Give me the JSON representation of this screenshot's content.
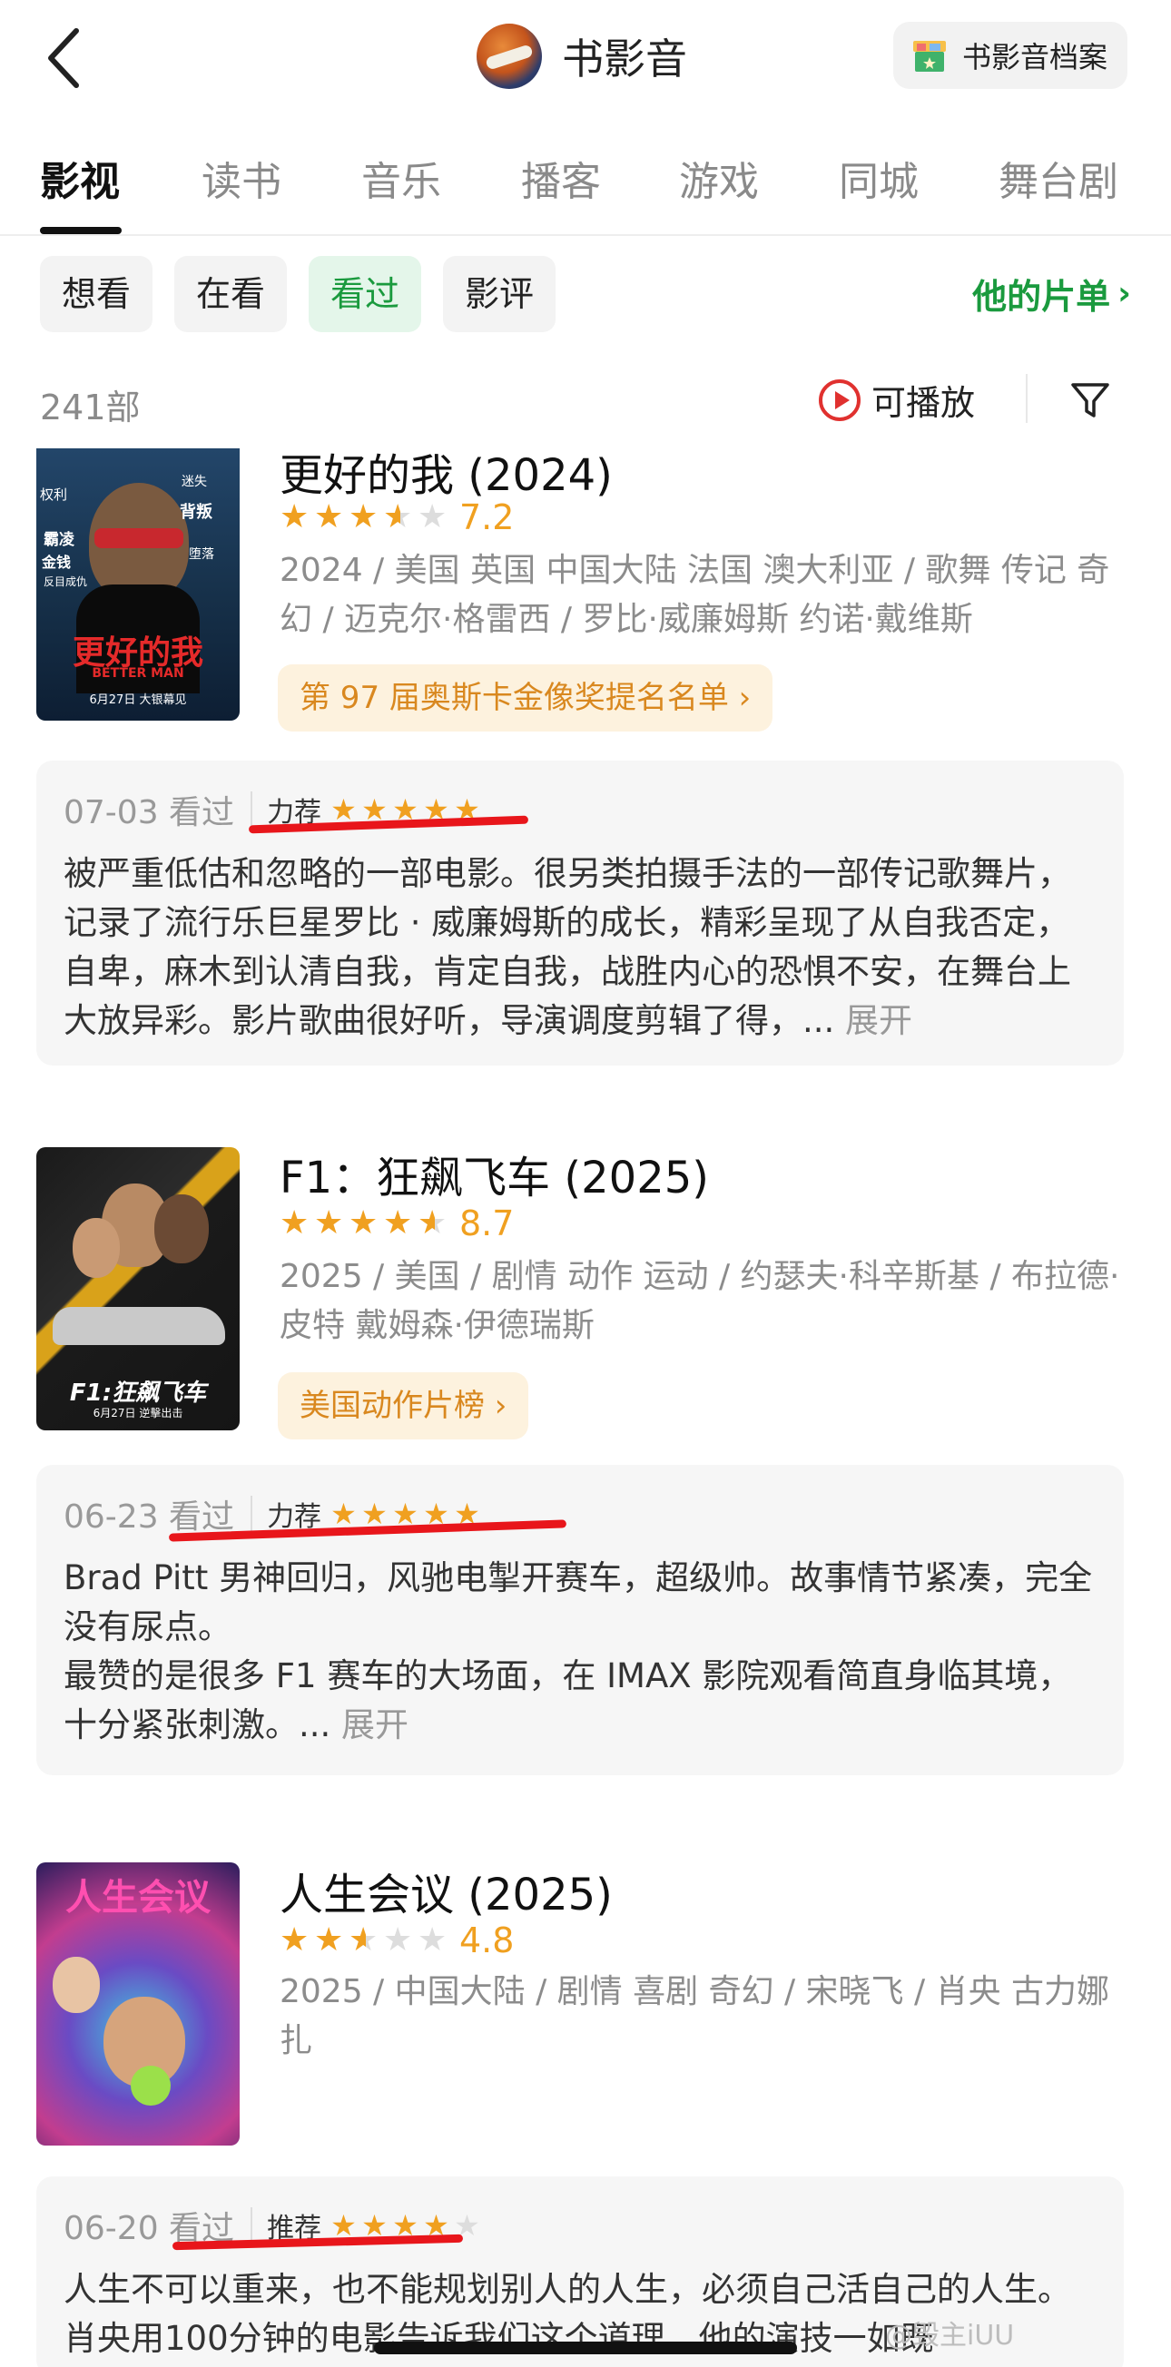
{
  "header": {
    "title": "书影音",
    "archive_label": "书影音档案",
    "accent": "#1a9a3e"
  },
  "tabs": [
    {
      "label": "影视",
      "active": true
    },
    {
      "label": "读书"
    },
    {
      "label": "音乐"
    },
    {
      "label": "播客"
    },
    {
      "label": "游戏"
    },
    {
      "label": "同城"
    },
    {
      "label": "舞台剧"
    }
  ],
  "filters": {
    "chips": [
      {
        "label": "想看"
      },
      {
        "label": "在看"
      },
      {
        "label": "看过",
        "active": true
      },
      {
        "label": "影评"
      }
    ],
    "my_list": "他的片单",
    "my_list_chevron": "›"
  },
  "list_meta": {
    "count": "241部",
    "playable": "可播放"
  },
  "movies": [
    {
      "title": "更好的我 (2024)",
      "stars": 3.5,
      "score": "7.2",
      "meta": "2024 / 美国 英国 中国大陆 法国 澳大利亚 / 歌舞 传记 奇幻 / 迈克尔·格雷西 / 罗比·威廉姆斯 约诺·戴维斯",
      "tag": "第 97 届奥斯卡金像奖提名名单 ›",
      "poster_text": "更好的我",
      "poster_subtext": "BETTER MAN",
      "poster_date": "6月27日 大银幕见",
      "poster_words": [
        "权利",
        "迷失",
        "背叛",
        "霸凌",
        "金钱",
        "堕落",
        "反目成仇"
      ],
      "review": {
        "date": "07-03 看过",
        "level": "力荐",
        "stars": 5,
        "text": "被严重低估和忽略的一部电影。很另类拍摄手法的一部传记歌舞片，记录了流行乐巨星罗比 · 威廉姆斯的成长，精彩呈现了从自我否定，自卑，麻木到认清自我，肯定自我，战胜内心的恐惧不安，在舞台上大放异彩。影片歌曲很好听，导演调度剪辑了得，... ",
        "expand": "展开"
      }
    },
    {
      "title": "F1：狂飙飞车 (2025)",
      "stars": 4.5,
      "score": "8.7",
      "meta": "2025 / 美国 / 剧情 动作 运动 / 约瑟夫·科辛斯基 / 布拉德·皮特 戴姆森·伊德瑞斯",
      "tag": "美国动作片榜 ›",
      "poster_text": "F1:狂飙飞车",
      "poster_date": "6月27日 逆擊出击",
      "review": {
        "date": "06-23 看过",
        "level": "力荐",
        "stars": 5,
        "text": "Brad Pitt 男神回归，风驰电掣开赛车，超级帅。故事情节紧凑，完全没有尿点。\n最赞的是很多 F1 赛车的大场面，在 IMAX 影院观看简直身临其境，十分紧张刺激。... ",
        "expand": "展开"
      }
    },
    {
      "title": "人生会议 (2025)",
      "stars": 2.5,
      "score": "4.8",
      "meta": "2025 / 中国大陆 / 剧情 喜剧 奇幻 / 宋晓飞 / 肖央 古力娜扎",
      "poster_text": "人生会议",
      "review": {
        "date": "06-20 看过",
        "level": "推荐",
        "stars": 4,
        "text": "人生不可以重来，也不能规划别人的人生，必须自己活自己的人生。肖央用100分钟的电影告诉我们这个道理。他的演技一如既",
        "expand": ""
      }
    }
  ],
  "colors": {
    "star_on": "#f0a020",
    "star_off": "#dddddd",
    "mark_red": "#e8161b"
  },
  "watermark": "@毁主iUU"
}
